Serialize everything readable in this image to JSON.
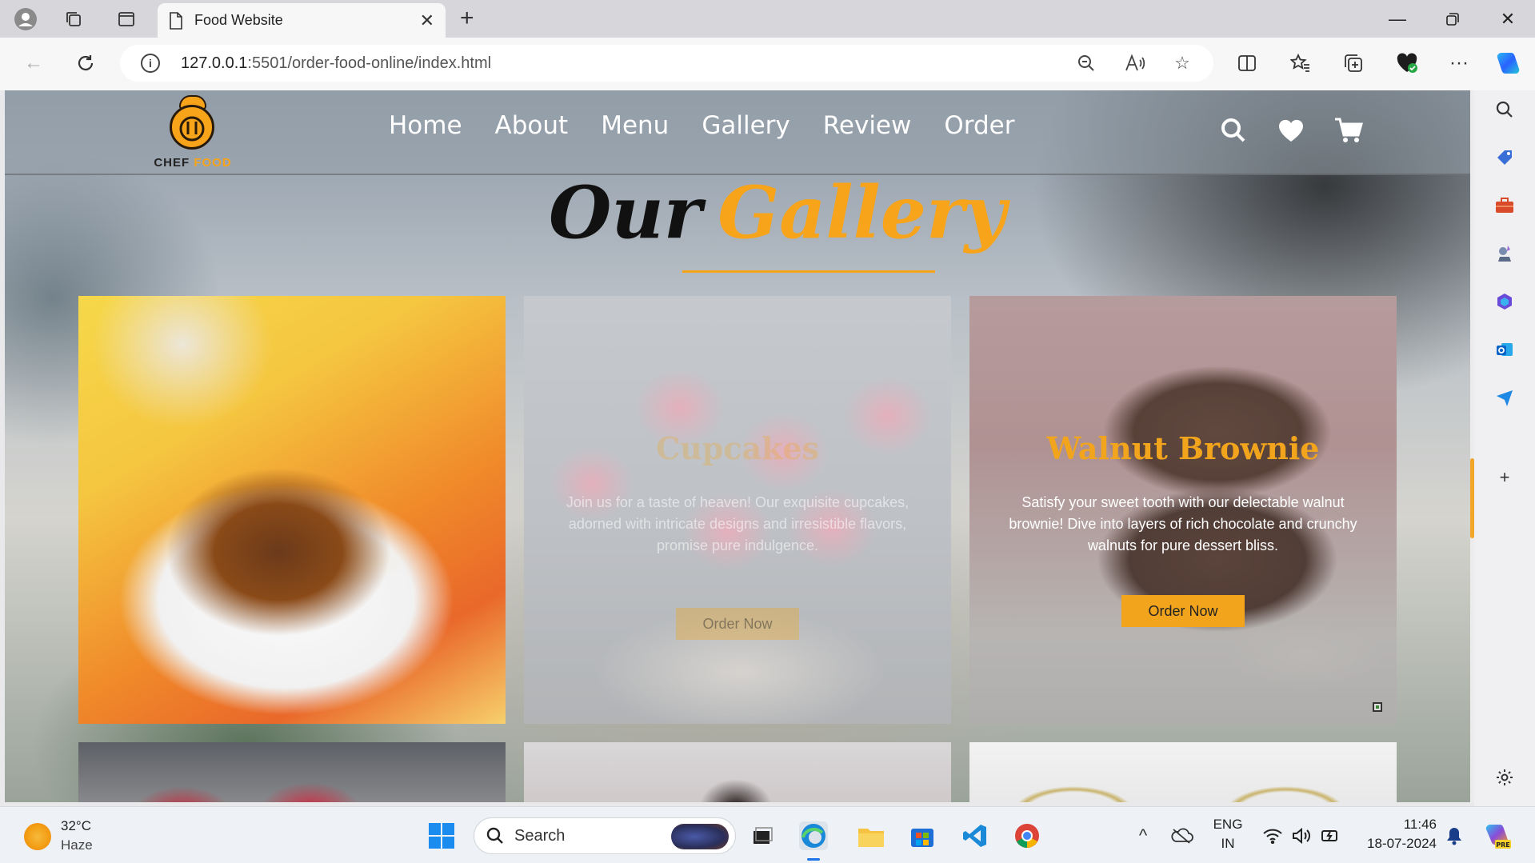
{
  "browser": {
    "tab_title": "Food Website",
    "url_host": "127.0.0.1",
    "url_rest": ":5501/order-food-online/index.html"
  },
  "site": {
    "logo_word1": "CHEF",
    "logo_word2": "FOOD",
    "nav": [
      "Home",
      "About",
      "Menu",
      "Gallery",
      "Review",
      "Order"
    ],
    "title_word1": "Our",
    "title_word2": "Gallery",
    "cards": [
      {
        "title": "",
        "desc": "",
        "button": ""
      },
      {
        "title": "Cupcakes",
        "desc": "Join us for a taste of heaven! Our exquisite cupcakes, adorned with intricate designs and irresistible flavors, promise pure indulgence.",
        "button": "Order Now"
      },
      {
        "title": "Walnut Brownie",
        "desc": "Satisfy your sweet tooth with our delectable walnut brownie! Dive into layers of rich chocolate and crunchy walnuts for pure dessert bliss.",
        "button": "Order Now"
      }
    ]
  },
  "taskbar": {
    "temp": "32°C",
    "weather": "Haze",
    "search": "Search",
    "lang1": "ENG",
    "lang2": "IN",
    "time": "11:46",
    "date": "18-07-2024"
  },
  "colors": {
    "accent": "#f7a41a",
    "scroll_thumb": "#f2a72a"
  }
}
